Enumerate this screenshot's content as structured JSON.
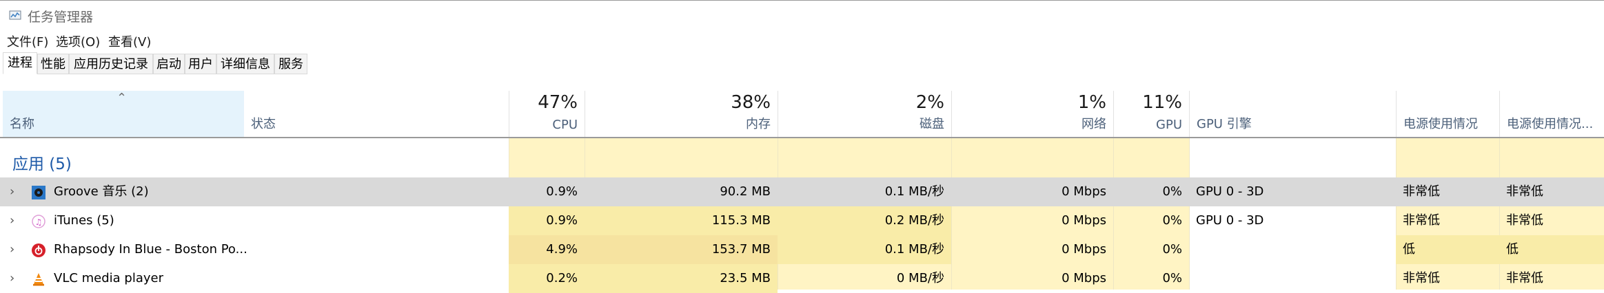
{
  "window": {
    "title": "任务管理器",
    "icon": "task-manager-icon"
  },
  "menu": [
    "文件(F)",
    "选项(O)",
    "查看(V)"
  ],
  "tabs": [
    "进程",
    "性能",
    "应用历史记录",
    "启动",
    "用户",
    "详细信息",
    "服务"
  ],
  "header": {
    "name": "名称",
    "status": "状态",
    "cpu": {
      "pct": "47%",
      "label": "CPU"
    },
    "memory": {
      "pct": "38%",
      "label": "内存"
    },
    "disk": {
      "pct": "2%",
      "label": "磁盘"
    },
    "network": {
      "pct": "1%",
      "label": "网络"
    },
    "gpu": {
      "pct": "11%",
      "label": "GPU"
    },
    "gpu_engine": "GPU 引擎",
    "power": "电源使用情况",
    "power_trend": "电源使用情况..."
  },
  "group": {
    "title": "应用 (5)"
  },
  "rows": [
    {
      "name": "Groove 音乐 (2)",
      "icon": "groove-music-icon",
      "cpu": "0.9%",
      "memory": "90.2 MB",
      "disk": "0.1 MB/秒",
      "network": "0 Mbps",
      "gpu": "0%",
      "gpu_engine": "GPU 0 - 3D",
      "power": "非常低",
      "power_trend": "非常低"
    },
    {
      "name": "iTunes (5)",
      "icon": "itunes-icon",
      "cpu": "0.9%",
      "memory": "115.3 MB",
      "disk": "0.2 MB/秒",
      "network": "0 Mbps",
      "gpu": "0%",
      "gpu_engine": "GPU 0 - 3D",
      "power": "非常低",
      "power_trend": "非常低"
    },
    {
      "name": "Rhapsody In Blue - Boston Po...",
      "icon": "netease-music-icon",
      "cpu": "4.9%",
      "memory": "153.7 MB",
      "disk": "0.1 MB/秒",
      "network": "0 Mbps",
      "gpu": "0%",
      "gpu_engine": "",
      "power": "低",
      "power_trend": "低"
    },
    {
      "name": "VLC media player",
      "icon": "vlc-icon",
      "cpu": "0.2%",
      "memory": "23.5 MB",
      "disk": "0 MB/秒",
      "network": "0 Mbps",
      "gpu": "0%",
      "gpu_engine": "",
      "power": "非常低",
      "power_trend": "非常低"
    }
  ],
  "colors": {
    "heat_light": "#fff4c4",
    "heat_mid": "#f9eca8",
    "heat_strong": "#f6e3a0",
    "selection": "#d9d9d9",
    "group_title": "#1e5aa8",
    "header_label": "#4c607a"
  }
}
